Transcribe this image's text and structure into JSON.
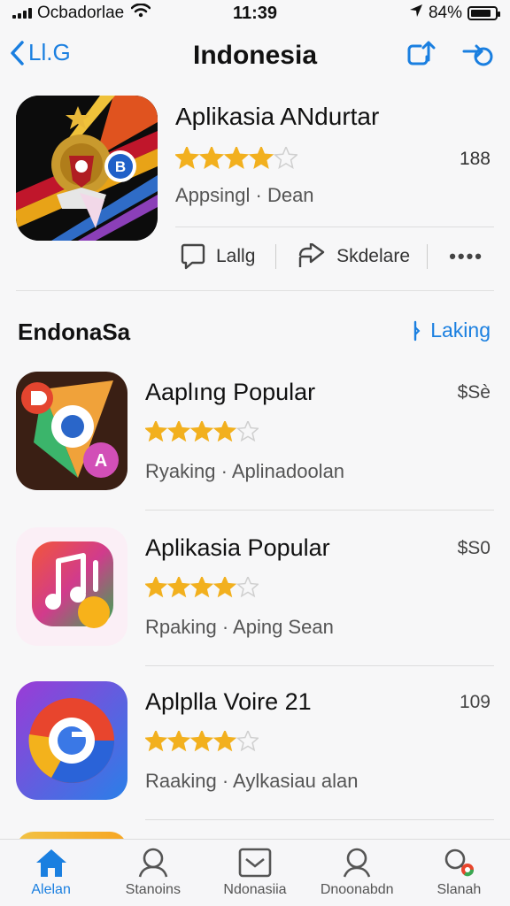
{
  "status_bar": {
    "carrier": "Ocbadorlae",
    "time": "11:39",
    "battery": "84%",
    "battery_level": 0.84
  },
  "nav": {
    "back_label": "Ll.G",
    "title": "Indonesia",
    "actions": [
      "share-icon",
      "refresh-icon"
    ]
  },
  "featured": {
    "title": "Aplikasia ANdurtar",
    "rating": 4,
    "rating_count": "188",
    "subtitle": "Appsingl · Dean",
    "actions": {
      "like": "Lallg",
      "share": "Skdelare",
      "more": "••••"
    }
  },
  "section": {
    "title": "EndonaSa",
    "link": "Laking"
  },
  "apps": [
    {
      "title": "Aaplıng Popular",
      "rating": 4,
      "price": "$Sè",
      "subtitle": "Ryaking ·  Aplinadoolan",
      "icon": "maps-icon"
    },
    {
      "title": "Aplikasia Popular",
      "rating": 4,
      "price": "$S0",
      "subtitle": "Rpaking · Aping Sean",
      "icon": "music-icon"
    },
    {
      "title": "Aplplla Voire 21",
      "rating": 4,
      "price": "109",
      "subtitle": "Raaking · Aylkasiau alan",
      "icon": "browser-icon"
    }
  ],
  "tabs": [
    {
      "label": "Alelan",
      "icon": "home-icon",
      "active": true
    },
    {
      "label": "Stanoins",
      "icon": "person-icon",
      "active": false
    },
    {
      "label": "Ndonasiia",
      "icon": "inbox-icon",
      "active": false
    },
    {
      "label": "Dnoonabdn",
      "icon": "search-person-icon",
      "active": false
    },
    {
      "label": "Slanah",
      "icon": "search-icon",
      "active": false
    }
  ],
  "colors": {
    "accent": "#1a7fe0",
    "star": "#f2b01e",
    "star_empty": "#cfcfcf"
  }
}
